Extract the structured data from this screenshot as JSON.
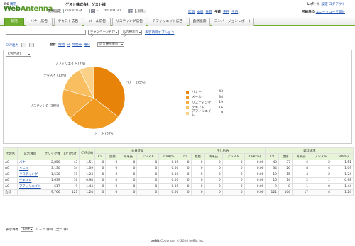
{
  "header": {
    "pc_label": "PC",
    "mobile_link": "携帯",
    "logo_web": "Web",
    "logo_antenna": "Antenna",
    "company": "ゲスト株式会社 ゲスト様",
    "period_label": "期間設定",
    "date_from": "2010/01/24",
    "date_to": "2010/01/30",
    "date_sep": "〜",
    "apply_label": "設定",
    "quick_ranges": [
      "昨日",
      "本日",
      "先週",
      "今週",
      "先月",
      "今月"
    ],
    "report_label": "レポート",
    "report_links": [
      "設定",
      "ログアウト"
    ],
    "unit_label": "回線単位",
    "unit_link": "ユニークユーザ単位"
  },
  "tabs": [
    "総括",
    "バナー広告",
    "テキスト広告",
    "メール広告",
    "リスティング広告",
    "アフィリエイト広告",
    "自然検索",
    "コンバージョンレポート"
  ],
  "filters": {
    "campaign_select": "キャンペーン名から",
    "ad_type_select": "広告種別から",
    "display_options_link": "表示項目オプション"
  },
  "toolbar": {
    "csv_link": "CSV出力",
    "summary_label": "合計",
    "time_links": [
      "時間",
      "日",
      "時間帯",
      "曜日"
    ],
    "unit_select": "広告種別単位",
    "metric_select": "CV(合計)"
  },
  "chart_data": {
    "type": "pie",
    "categories": [
      "バナー",
      "メール",
      "リスティング",
      "テキスト",
      "アフィリエイト"
    ],
    "values": [
      43,
      34,
      19,
      16,
      9
    ],
    "slice_labels": [
      "バナー (35%)",
      "メール (28%)",
      "リスティング (16%)",
      "テキスト (13%)",
      "アフィリエイト (7%)"
    ],
    "colors": [
      "#e8830a",
      "#f09a22",
      "#f5ac40",
      "#f8be60",
      "#fbd187"
    ]
  },
  "table": {
    "header_row1": [
      "代理店",
      "広告種別",
      "クリック数",
      "CV\n(合計)",
      "CVR(%)",
      "会員登録",
      "申し込み",
      "資料請求"
    ],
    "sub_headers": [
      "CV",
      "直接",
      "再来訪",
      "アシスト",
      "CVR(%)"
    ],
    "rows": [
      [
        "AG",
        "バナー",
        "2,850",
        "43",
        "1.51",
        "0",
        "0",
        "0",
        "0",
        "0.00",
        "0",
        "0",
        "0",
        "0",
        "0.00",
        "43",
        "37",
        "6",
        "2",
        "1.51"
      ],
      [
        "AG",
        "メール",
        "3,130",
        "34",
        "1.09",
        "0",
        "0",
        "0",
        "0",
        "0.00",
        "0",
        "0",
        "0",
        "0",
        "0.00",
        "34",
        "26",
        "8",
        "4",
        "1.09"
      ],
      [
        "AG",
        "リスティング",
        "1,530",
        "19",
        "1.24",
        "0",
        "0",
        "0",
        "0",
        "0.00",
        "0",
        "0",
        "0",
        "0",
        "0.00",
        "19",
        "15",
        "4",
        "2",
        "1.24"
      ],
      [
        "AG",
        "テキスト",
        "1,639",
        "16",
        "0.98",
        "0",
        "0",
        "0",
        "0",
        "0.00",
        "0",
        "0",
        "0",
        "0",
        "0.00",
        "16",
        "14",
        "2",
        "1",
        "0.98"
      ],
      [
        "AG",
        "アフィリエイト",
        "617",
        "9",
        "1.44",
        "0",
        "0",
        "0",
        "0",
        "0.00",
        "0",
        "0",
        "0",
        "0",
        "0.00",
        "9",
        "8",
        "1",
        "0",
        "1.44"
      ]
    ],
    "total": [
      "合計",
      "",
      "9,766",
      "121",
      "1.24",
      "0",
      "0",
      "0",
      "0",
      "0.00",
      "0",
      "0",
      "0",
      "0",
      "0.00",
      "121",
      "104",
      "17",
      "4",
      "1.24"
    ]
  },
  "pagination": {
    "label": "表示件数",
    "per_page": "10件",
    "summary": "1 － 5 件目（全 5 件）"
  },
  "footer": {
    "logo": "beBit",
    "copyright": "Copyright © 2010 beBit, Inc."
  }
}
